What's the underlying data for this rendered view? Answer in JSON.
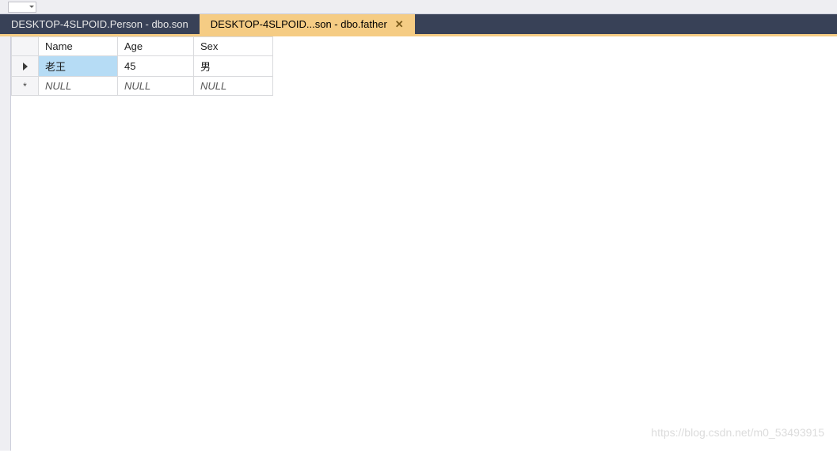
{
  "tabs": [
    {
      "label": "DESKTOP-4SLPOID.Person - dbo.son",
      "active": false
    },
    {
      "label": "DESKTOP-4SLPOID...son - dbo.father",
      "active": true
    }
  ],
  "grid": {
    "columns": [
      "Name",
      "Age",
      "Sex"
    ],
    "rows": [
      {
        "indicator": "current",
        "cells": [
          "老王",
          "45",
          "男"
        ],
        "null_flags": [
          false,
          false,
          false
        ],
        "selected_col": 0
      },
      {
        "indicator": "new",
        "cells": [
          "NULL",
          "NULL",
          "NULL"
        ],
        "null_flags": [
          true,
          true,
          true
        ],
        "selected_col": -1
      }
    ]
  },
  "watermark": "https://blog.csdn.net/m0_53493915"
}
